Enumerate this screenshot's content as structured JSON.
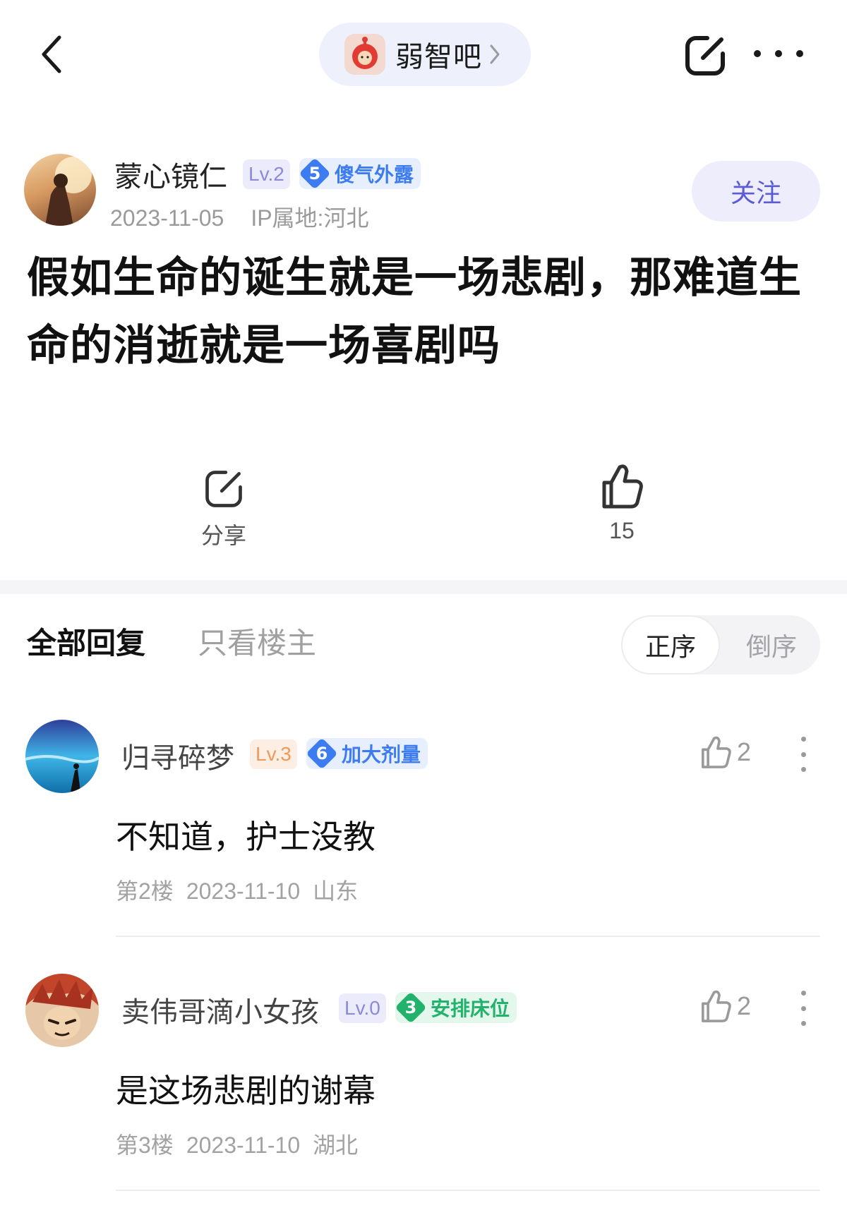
{
  "topbar": {
    "forum_name": "弱智吧"
  },
  "post": {
    "author": {
      "name": "蒙心镜仁",
      "level": "Lv.2",
      "honor_level": "5",
      "honor_title": "傻气外露",
      "date": "2023-11-05",
      "ip_location": "IP属地:河北"
    },
    "follow_label": "关注",
    "title": "假如生命的诞生就是一场悲剧，那难道生命的消逝就是一场喜剧吗",
    "share_label": "分享",
    "like_count": "15"
  },
  "tabs": {
    "all": "全部回复",
    "owner_only": "只看楼主",
    "sort_asc": "正序",
    "sort_desc": "倒序"
  },
  "comments": [
    {
      "name": "归寻碎梦",
      "level": "Lv.3",
      "honor_level": "6",
      "honor_title": "加大剂量",
      "likes": "2",
      "text": "不知道，护士没教",
      "floor": "第2楼",
      "date": "2023-11-10",
      "location": "山东"
    },
    {
      "name": "卖伟哥滴小女孩",
      "level": "Lv.0",
      "honor_level": "3",
      "honor_title": "安排床位",
      "likes": "2",
      "text": "是这场悲剧的谢幕",
      "floor": "第3楼",
      "date": "2023-11-10",
      "location": "湖北"
    }
  ],
  "colors": {
    "accent": "#5b5bd6",
    "honor_blue": "#3d7cf0",
    "honor_green": "#23b26b",
    "lv_purple_bg": "#ecebfb",
    "lv_purple_text": "#8c89d9",
    "lv_orange_bg": "#fdeee3",
    "lv_orange_text": "#ef9a5a"
  }
}
